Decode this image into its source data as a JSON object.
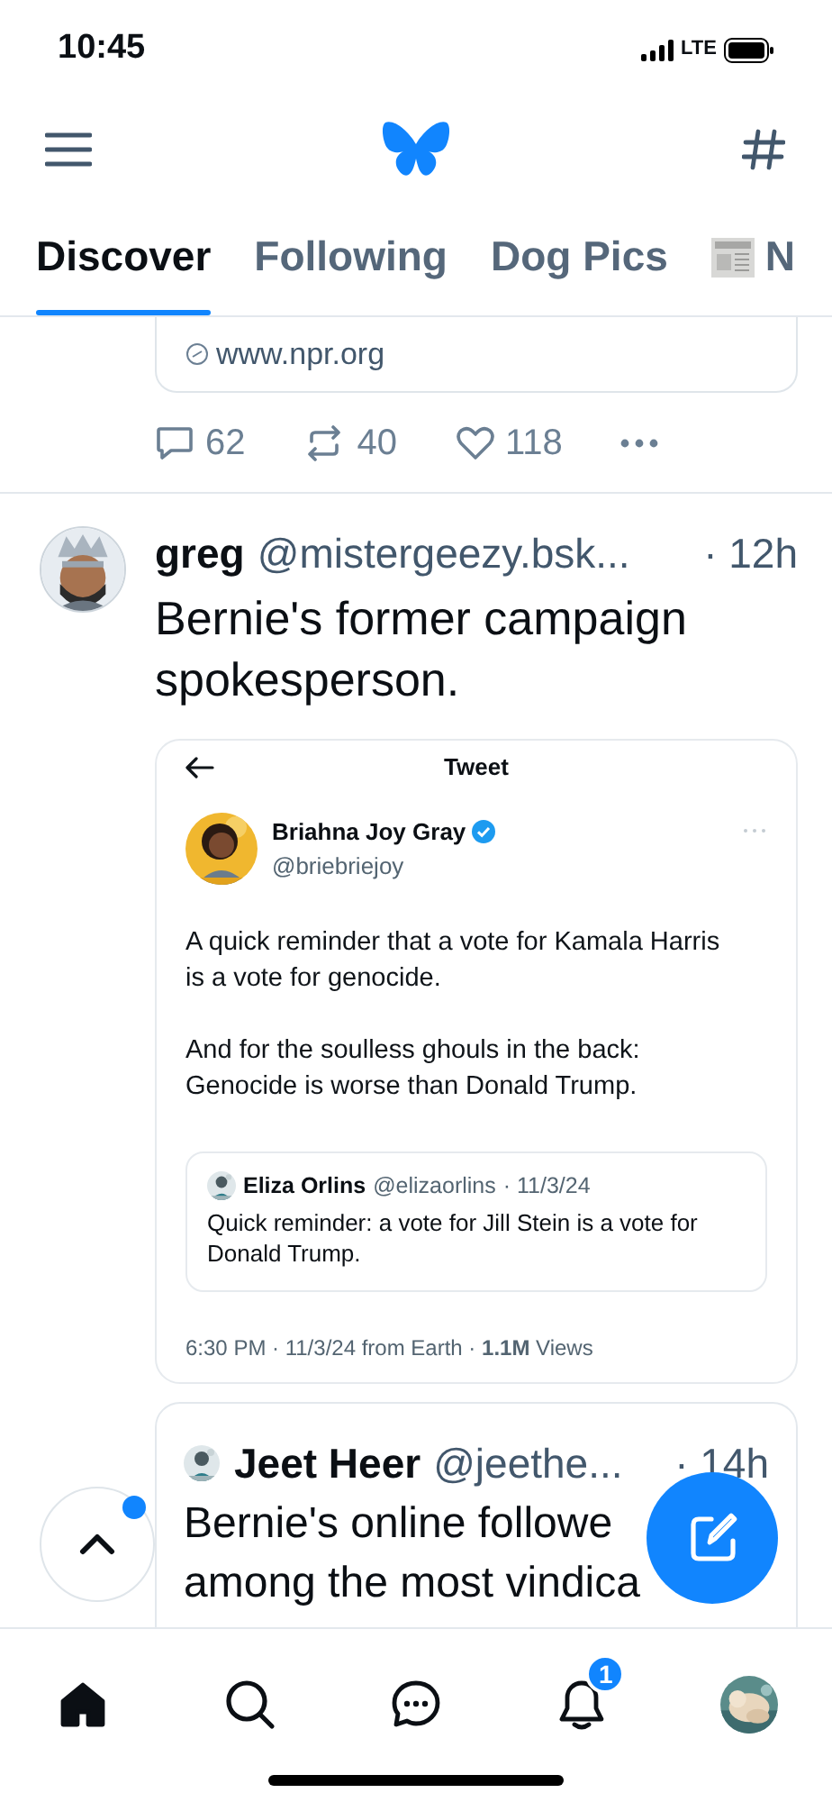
{
  "status_bar": {
    "time": "10:45",
    "network": "LTE"
  },
  "tabs": [
    {
      "label": "Discover",
      "selected": true,
      "kind": "text"
    },
    {
      "label": "Following",
      "selected": false,
      "kind": "text"
    },
    {
      "label": "Dog Pics",
      "selected": false,
      "kind": "text"
    },
    {
      "label": "N",
      "selected": false
    }
  ],
  "previous_post": {
    "link_domain": "www.npr.org",
    "replies": "62",
    "reposts": "40",
    "likes": "118"
  },
  "post": {
    "author": "greg",
    "handle": "@mistergeezy.bsk...",
    "time": "· 12h",
    "text": "Bernie's former campaign spokesperson.",
    "embedded_screenshot": {
      "title": "Tweet",
      "author": "Briahna Joy Gray",
      "verified": true,
      "handle": "@briebriejoy",
      "paragraphs": [
        "A quick reminder that a vote for Kamala Harris is a vote for genocide.",
        "And for the soulless ghouls in the back: Genocide is worse than Donald Trump."
      ],
      "quote": {
        "author": "Eliza Orlins",
        "handle": "@elizaorlins",
        "date": "· 11/3/24",
        "text": "Quick reminder: a vote for Jill Stein is a vote for Donald Trump."
      },
      "meta": "6:30 PM · 11/3/24 from Earth · **1.1M** Views"
    }
  },
  "quoted_post": {
    "author": "Jeet Heer",
    "handle": "@jeethe...",
    "time": "· 14h",
    "lines": [
      "Bernie's online followe",
      "among the most vindica"
    ]
  },
  "scroll_top": {
    "unread": true
  },
  "bottom_nav": [
    {
      "kind": "home",
      "selected": true
    },
    {
      "kind": "search",
      "selected": false
    },
    {
      "kind": "chat",
      "selected": false
    },
    {
      "kind": "notifications",
      "selected": false,
      "badge": "1"
    },
    {
      "kind": "profile",
      "selected": false
    }
  ]
}
